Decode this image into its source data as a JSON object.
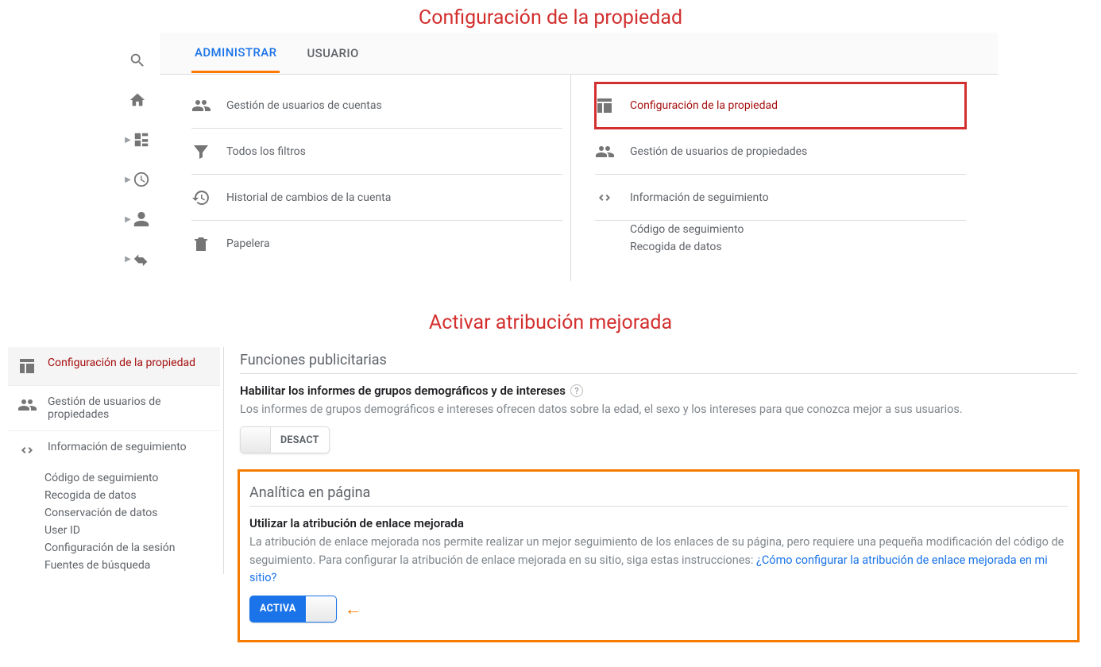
{
  "annotations": {
    "top_title": "Configuración de la propiedad",
    "bottom_title": "Activar atribución mejorada",
    "arrow": "←"
  },
  "tabs": {
    "admin": "ADMINISTRAR",
    "user": "USUARIO"
  },
  "account_col": {
    "user_mgmt": "Gestión de usuarios de cuentas",
    "filters": "Todos los filtros",
    "history": "Historial de cambios de la cuenta",
    "trash": "Papelera"
  },
  "property_col": {
    "settings": "Configuración de la propiedad",
    "user_mgmt": "Gestión de usuarios de propiedades",
    "tracking": "Información de seguimiento",
    "tracking_code": "Código de seguimiento",
    "data_collection": "Recogida de datos"
  },
  "left_nav": {
    "settings": "Configuración de la propiedad",
    "user_mgmt": "Gestión de usuarios de propiedades",
    "tracking": "Información de seguimiento",
    "sub": {
      "tracking_code": "Código de seguimiento",
      "data_collection": "Recogida de datos",
      "data_retention": "Conservación de datos",
      "user_id": "User ID",
      "session_settings": "Configuración de la sesión",
      "search_sources": "Fuentes de búsqueda"
    }
  },
  "ad_features": {
    "section": "Funciones publicitarias",
    "head": "Habilitar los informes de grupos demográficos y de intereses",
    "desc": "Los informes de grupos demográficos e intereses ofrecen datos sobre la edad, el sexo y los intereses para que conozca mejor a sus usuarios.",
    "toggle": "DESACT"
  },
  "inpage": {
    "section": "Analítica en página",
    "head": "Utilizar la atribución de enlace mejorada",
    "desc_a": "La atribución de enlace mejorada nos permite realizar un mejor seguimiento de los enlaces de su página, pero requiere una pequeña modificación del código de seguimiento. Para configurar la atribución de enlace mejorada en su sitio, siga estas instrucciones: ",
    "link": "¿Cómo configurar la atribución de enlace mejorada en mi sitio?",
    "toggle": "ACTIVA"
  }
}
